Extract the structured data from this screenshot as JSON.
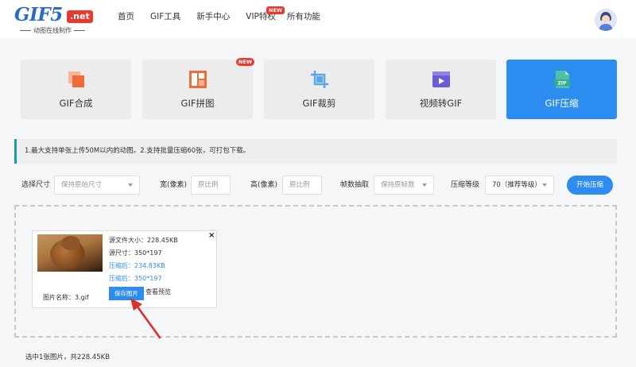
{
  "header": {
    "logo_main": "GIF5",
    "logo_net": ".net",
    "logo_sub": "动图在线制作",
    "nav": [
      "首页",
      "GIF工具",
      "新手中心",
      "VIP特权",
      "所有功能"
    ],
    "new_badge": "NEW"
  },
  "tools": [
    {
      "label": "GIF合成",
      "icon": "gif-merge-icon"
    },
    {
      "label": "GIF拼图",
      "icon": "gif-collage-icon",
      "badge": "NEW"
    },
    {
      "label": "GIF裁剪",
      "icon": "gif-crop-icon"
    },
    {
      "label": "视频转GIF",
      "icon": "video-to-gif-icon"
    },
    {
      "label": "GIF压缩",
      "icon": "gif-compress-icon",
      "active": true
    }
  ],
  "notice": "1.最大支持单张上传50M以内的动图。2.支持批量压缩60张，可打包下载。",
  "options": {
    "size_label": "选择尺寸",
    "size_value": "保持原始尺寸",
    "width_label": "宽(像素)",
    "width_placeholder": "原比例",
    "height_label": "高(像素)",
    "height_placeholder": "原比例",
    "frame_label": "帧数抽取",
    "frame_value": "保持原帧数",
    "level_label": "压缩等级",
    "level_value": "70（推荐等级）",
    "start_button": "开始压缩"
  },
  "file": {
    "orig_size": "源文件大小：228.45KB",
    "orig_dims": "源尺寸：350*197",
    "comp_size": "压缩后：234.83KB",
    "comp_dims": "压缩后：350*197",
    "name": "图片名称：3.gif",
    "save_button": "保存图片",
    "preview_link": "查看预览",
    "close": "×"
  },
  "footer": "选中1张图片，共228.45KB",
  "colors": {
    "accent": "#2d8cf0",
    "notice_bar": "#1b9aa7",
    "badge": "#e9382f",
    "icon_orange": "#f06b3a",
    "annotation_arrow": "#d9302c"
  }
}
